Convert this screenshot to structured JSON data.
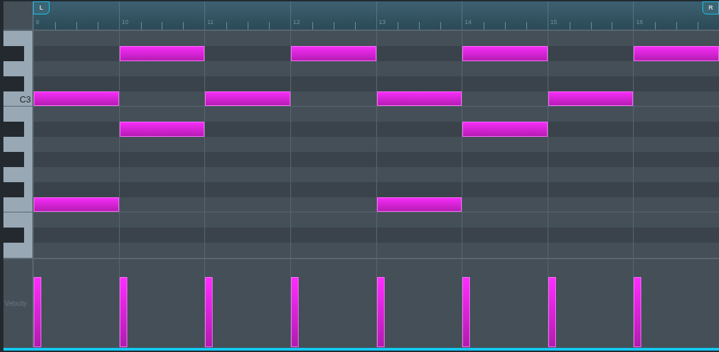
{
  "ruler": {
    "bars": [
      "9",
      "10",
      "11",
      "12",
      "13",
      "14",
      "15",
      "16"
    ],
    "loop_start": "L",
    "loop_end": "R"
  },
  "keys": [
    {
      "kind": "white",
      "boundary": false,
      "steps": [
        false,
        false,
        false,
        false,
        false,
        false,
        false,
        false
      ]
    },
    {
      "kind": "black",
      "boundary": false,
      "steps": [
        false,
        true,
        false,
        true,
        false,
        true,
        false,
        true
      ]
    },
    {
      "kind": "white",
      "boundary": false,
      "steps": [
        false,
        false,
        false,
        false,
        false,
        false,
        false,
        false
      ]
    },
    {
      "kind": "black",
      "boundary": false,
      "steps": [
        false,
        false,
        false,
        false,
        false,
        false,
        false,
        false
      ]
    },
    {
      "kind": "white",
      "boundary": true,
      "label": "C3",
      "steps": [
        true,
        false,
        true,
        false,
        true,
        false,
        true,
        false
      ]
    },
    {
      "kind": "white",
      "boundary": false,
      "steps": [
        false,
        false,
        false,
        false,
        false,
        false,
        false,
        false
      ]
    },
    {
      "kind": "black",
      "boundary": false,
      "steps": [
        false,
        true,
        false,
        false,
        false,
        true,
        false,
        false
      ]
    },
    {
      "kind": "white",
      "boundary": false,
      "steps": [
        false,
        false,
        false,
        false,
        false,
        false,
        false,
        false
      ]
    },
    {
      "kind": "black",
      "boundary": false,
      "steps": [
        false,
        false,
        false,
        false,
        false,
        false,
        false,
        false
      ]
    },
    {
      "kind": "white",
      "boundary": false,
      "steps": [
        false,
        false,
        false,
        false,
        false,
        false,
        false,
        false
      ]
    },
    {
      "kind": "black",
      "boundary": false,
      "steps": [
        false,
        false,
        false,
        false,
        false,
        false,
        false,
        false
      ]
    },
    {
      "kind": "white",
      "boundary": true,
      "steps": [
        true,
        false,
        false,
        false,
        true,
        false,
        false,
        false
      ]
    },
    {
      "kind": "white",
      "boundary": false,
      "steps": [
        false,
        false,
        false,
        false,
        false,
        false,
        false,
        false
      ]
    },
    {
      "kind": "black",
      "boundary": false,
      "steps": [
        false,
        false,
        false,
        false,
        false,
        false,
        false,
        false
      ]
    },
    {
      "kind": "white",
      "boundary": false,
      "steps": [
        false,
        false,
        false,
        false,
        false,
        false,
        false,
        false
      ]
    }
  ],
  "velocity": {
    "label": "Velocity",
    "bars": [
      {
        "level": 0.8
      },
      {
        "level": 0.8
      },
      {
        "level": 0.8
      },
      {
        "level": 0.8
      },
      {
        "level": 0.8
      },
      {
        "level": 0.8
      },
      {
        "level": 0.8
      },
      {
        "level": 0.8
      }
    ]
  }
}
